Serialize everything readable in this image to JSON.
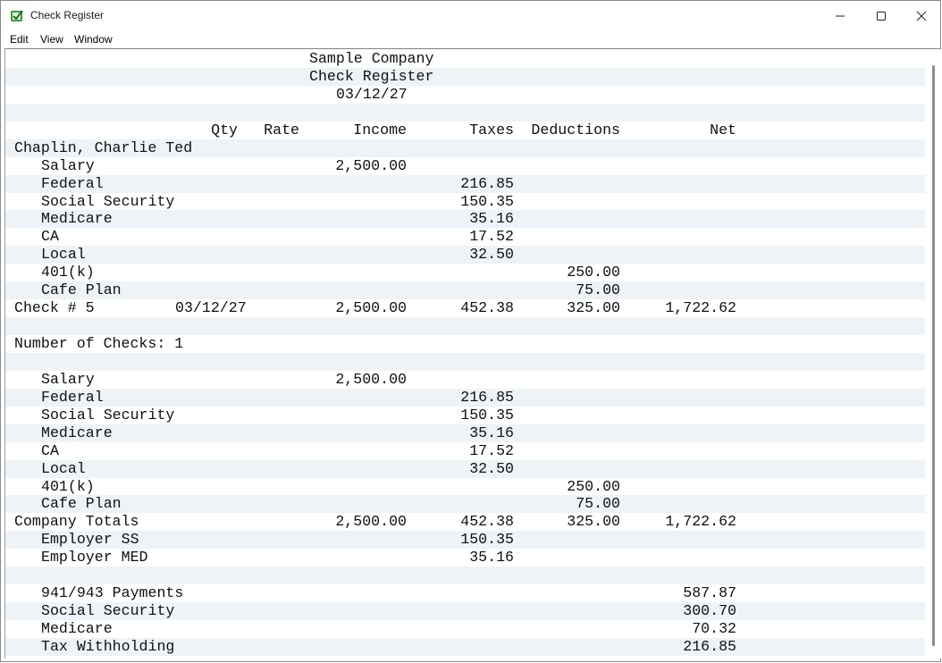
{
  "window": {
    "title": "Check Register"
  },
  "menu": {
    "items": [
      "Edit",
      "View",
      "Window"
    ]
  },
  "report": {
    "company": "Sample Company",
    "title": "Check Register",
    "date": "03/12/27",
    "headers": {
      "qty": "Qty",
      "rate": "Rate",
      "income": "Income",
      "taxes": "Taxes",
      "deductions": "Deductions",
      "net": "Net"
    },
    "rows": [
      {
        "label": "",
        "indent": false
      },
      {
        "label": "",
        "indent": false
      },
      {
        "label": "",
        "indent": false
      },
      {
        "label": "",
        "indent": false
      },
      {
        "header": true
      },
      {
        "label": "Chaplin, Charlie Ted",
        "indent": false
      },
      {
        "label": "Salary",
        "indent": true,
        "income": "2,500.00"
      },
      {
        "label": "Federal",
        "indent": true,
        "taxes": "216.85"
      },
      {
        "label": "Social Security",
        "indent": true,
        "taxes": "150.35"
      },
      {
        "label": "Medicare",
        "indent": true,
        "taxes": "35.16"
      },
      {
        "label": "CA",
        "indent": true,
        "taxes": "17.52"
      },
      {
        "label": "Local",
        "indent": true,
        "taxes": "32.50"
      },
      {
        "label": "401(k)",
        "indent": true,
        "deductions": "250.00"
      },
      {
        "label": "Cafe Plan",
        "indent": true,
        "deductions": "75.00"
      },
      {
        "label": "Check # 5",
        "indent": false,
        "rate": "03/12/27",
        "income": "2,500.00",
        "taxes": "452.38",
        "deductions": "325.00",
        "net": "1,722.62"
      },
      {
        "label": "",
        "indent": false
      },
      {
        "label": "Number of Checks: 1",
        "indent": false
      },
      {
        "label": "",
        "indent": false
      },
      {
        "label": "Salary",
        "indent": true,
        "income": "2,500.00"
      },
      {
        "label": "Federal",
        "indent": true,
        "taxes": "216.85"
      },
      {
        "label": "Social Security",
        "indent": true,
        "taxes": "150.35"
      },
      {
        "label": "Medicare",
        "indent": true,
        "taxes": "35.16"
      },
      {
        "label": "CA",
        "indent": true,
        "taxes": "17.52"
      },
      {
        "label": "Local",
        "indent": true,
        "taxes": "32.50"
      },
      {
        "label": "401(k)",
        "indent": true,
        "deductions": "250.00"
      },
      {
        "label": "Cafe Plan",
        "indent": true,
        "deductions": "75.00"
      },
      {
        "label": "Company Totals",
        "indent": false,
        "income": "2,500.00",
        "taxes": "452.38",
        "deductions": "325.00",
        "net": "1,722.62"
      },
      {
        "label": "Employer SS",
        "indent": true,
        "taxes": "150.35"
      },
      {
        "label": "Employer MED",
        "indent": true,
        "taxes": "35.16"
      },
      {
        "label": "",
        "indent": false
      },
      {
        "label": "941/943 Payments",
        "indent": true,
        "net": "587.87"
      },
      {
        "label": "Social Security",
        "indent": true,
        "net": "300.70"
      },
      {
        "label": "Medicare",
        "indent": true,
        "net": "70.32"
      },
      {
        "label": "Tax Withholding",
        "indent": true,
        "net": "216.85"
      }
    ]
  }
}
